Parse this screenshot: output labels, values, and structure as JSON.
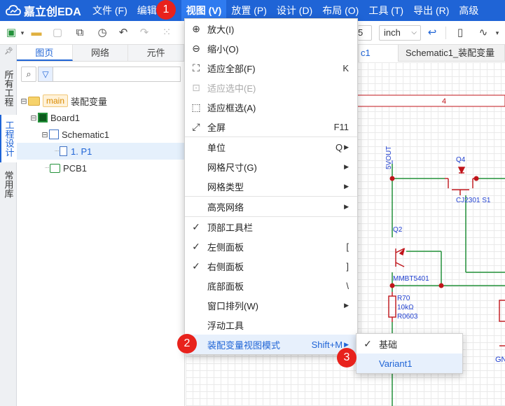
{
  "app": {
    "logo_text": "嘉立创EDA"
  },
  "menubar": {
    "items": [
      "文件 (F)",
      "编辑",
      "视图 (V)",
      "放置 (P)",
      "设计 (D)",
      "布局 (O)",
      "工具 (T)",
      "导出 (R)",
      "高级"
    ],
    "active": "视图 (V)"
  },
  "toolbar": {
    "unit_value": "inch",
    "num_value": "5"
  },
  "left_tabs": [
    "所有工程",
    "工程设计",
    "常用库"
  ],
  "panel": {
    "tabs": [
      "图页",
      "网络",
      "元件"
    ],
    "tree": {
      "root_tag": "main",
      "root_label": "装配变量",
      "board": "Board1",
      "schematic": "Schematic1",
      "page": "1. P1",
      "pcb": "PCB1"
    }
  },
  "doc_tabs": [
    "c1",
    "Schematic1_装配变量"
  ],
  "schematic": {
    "ruler_label": "4",
    "net_label": "5VOUT",
    "q4": "Q4",
    "q4_part": "CJ2301 S1",
    "q2": "Q2",
    "q2_part": "MMBT5401",
    "r70": "R70",
    "r70_value": "10kΩ",
    "r70_pkg": "R0603",
    "gnd_partial": "GN"
  },
  "view_menu": {
    "items": [
      {
        "icon": "zoom-in-icon",
        "glyph": "⊕",
        "label": "放大(I)",
        "shortcut": ""
      },
      {
        "icon": "zoom-out-icon",
        "glyph": "⊖",
        "label": "缩小(O)",
        "shortcut": ""
      },
      {
        "icon": "fit-all-icon",
        "glyph": "⛶",
        "label": "适应全部(F)",
        "shortcut": "K"
      },
      {
        "icon": "fit-selected-icon",
        "glyph": "⊡",
        "label": "适应选中(E)",
        "shortcut": ""
      },
      {
        "icon": "fit-box-icon",
        "glyph": "⬚",
        "label": "适应框选(A)",
        "shortcut": ""
      },
      {
        "icon": "fullscreen-icon",
        "glyph": "⤢",
        "label": "全屏",
        "shortcut": "F11"
      },
      {
        "icon": "",
        "glyph": "",
        "label": "单位",
        "shortcut": "Q"
      },
      {
        "icon": "",
        "glyph": "",
        "label": "网格尺寸(G)",
        "shortcut": ""
      },
      {
        "icon": "",
        "glyph": "",
        "label": "网格类型",
        "shortcut": ""
      },
      {
        "icon": "",
        "glyph": "",
        "label": "高亮网络",
        "shortcut": ""
      },
      {
        "icon": "check-icon",
        "glyph": "✓",
        "label": "顶部工具栏",
        "shortcut": ""
      },
      {
        "icon": "check-icon",
        "glyph": "✓",
        "label": "左侧面板",
        "shortcut": "["
      },
      {
        "icon": "check-icon",
        "glyph": "✓",
        "label": "右侧面板",
        "shortcut": "]"
      },
      {
        "icon": "",
        "glyph": "",
        "label": "底部面板",
        "shortcut": "\\"
      },
      {
        "icon": "",
        "glyph": "",
        "label": "窗口排列(W)",
        "shortcut": ""
      },
      {
        "icon": "",
        "glyph": "",
        "label": "浮动工具",
        "shortcut": ""
      },
      {
        "icon": "",
        "glyph": "",
        "label": "装配变量视图模式",
        "shortcut": "Shift+M"
      }
    ]
  },
  "submenu": {
    "items": [
      "基础",
      "Variant1"
    ]
  },
  "badges": [
    "1",
    "2",
    "3"
  ],
  "colors": {
    "brand": "#1f64d6",
    "badge": "#e8221c",
    "wire": "#23913a",
    "component": "#c0151b",
    "net_text": "#1f3fcf"
  }
}
